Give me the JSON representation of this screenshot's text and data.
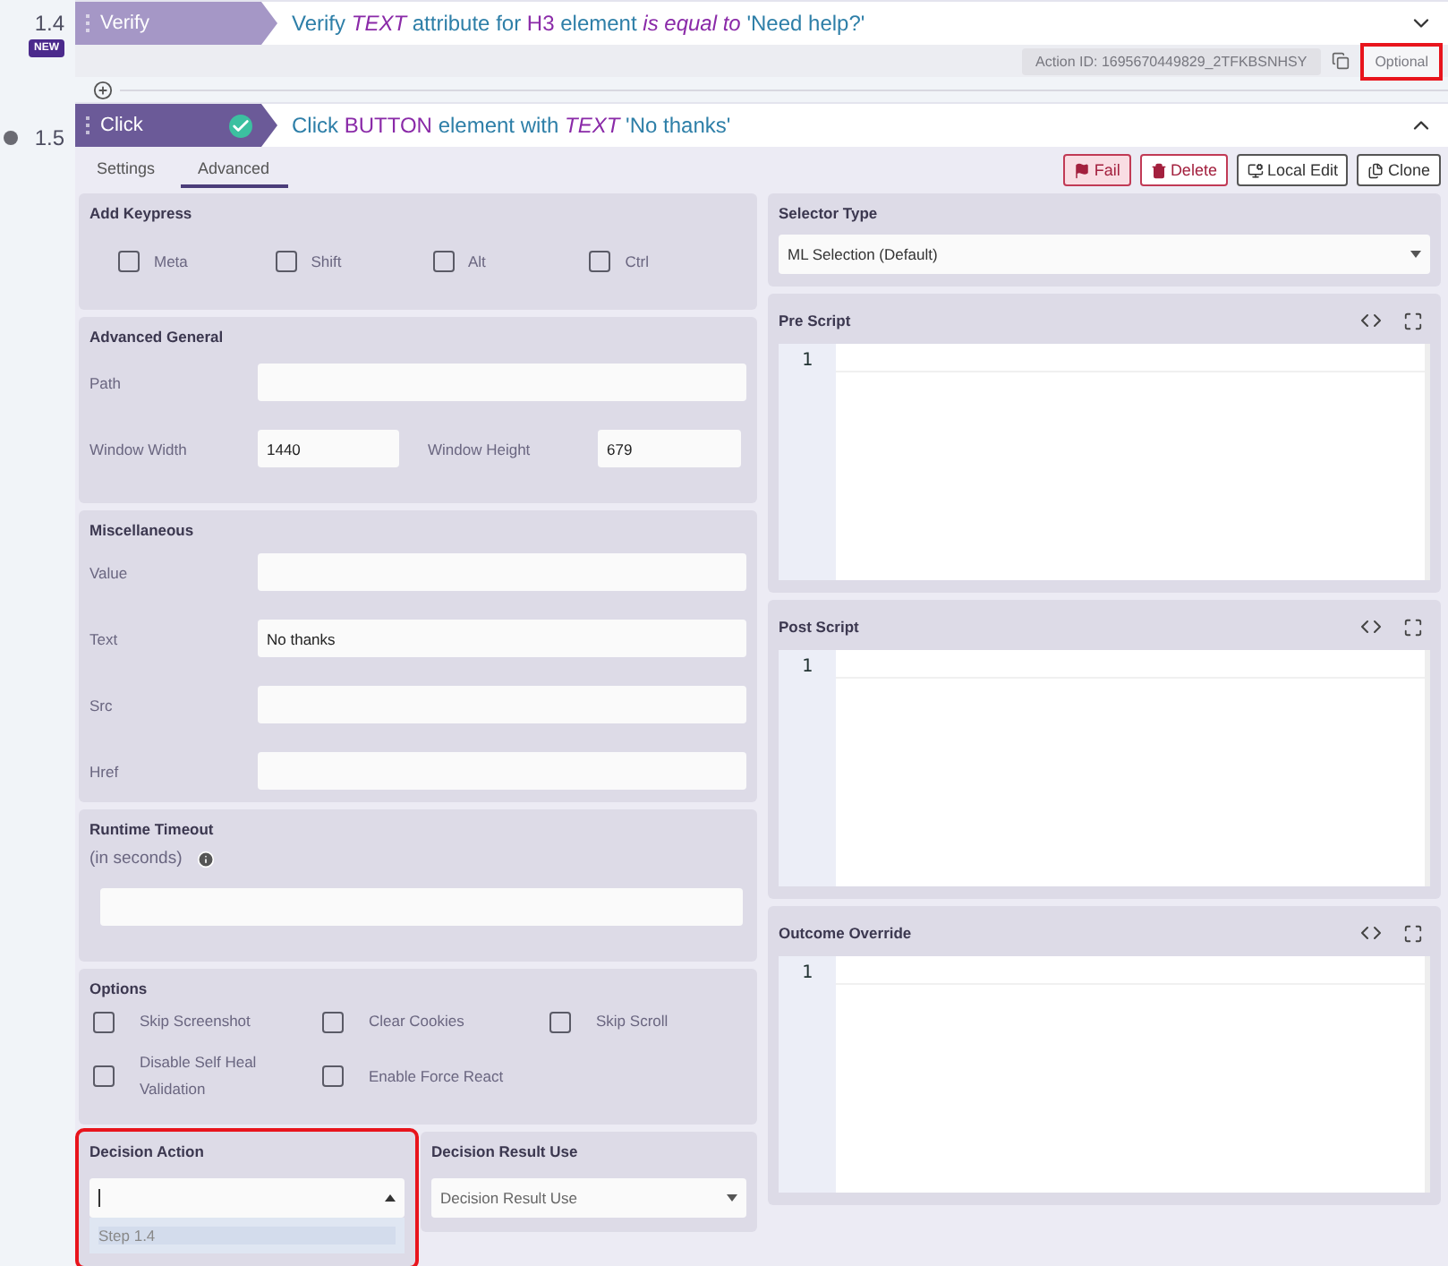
{
  "previous_step": {
    "number": "1.4",
    "badge": "NEW",
    "action": "Verify",
    "active": false,
    "expanded": false,
    "description": [
      {
        "text": "Verify",
        "kind": "plain"
      },
      {
        "text": "TEXT",
        "kind": "em"
      },
      {
        "text": "attribute for",
        "kind": "plain"
      },
      {
        "text": "H3",
        "kind": "key"
      },
      {
        "text": "element",
        "kind": "plain"
      },
      {
        "text": "is equal to",
        "kind": "em"
      },
      {
        "text": "'Need help?'",
        "kind": "plain"
      }
    ],
    "action_id": "Action ID: 1695670449829_2TFKBSNHSY",
    "optional_button": {
      "label": "Optional",
      "highlighted": true
    }
  },
  "current_step": {
    "number": "1.5",
    "action": "Click",
    "active": true,
    "passed": true,
    "expanded": true,
    "description": [
      {
        "text": "Click",
        "kind": "plain"
      },
      {
        "text": "BUTTON",
        "kind": "key"
      },
      {
        "text": "element with",
        "kind": "plain"
      },
      {
        "text": "TEXT",
        "kind": "em"
      },
      {
        "text": "'No thanks'",
        "kind": "plain"
      }
    ],
    "tabs": [
      {
        "label": "Settings",
        "selected": false
      },
      {
        "label": "Advanced",
        "selected": true
      }
    ],
    "buttons": [
      {
        "label": "Fail",
        "kind": "fail"
      },
      {
        "label": "Delete",
        "kind": "delete"
      },
      {
        "label": "Local Edit",
        "kind": "edit"
      },
      {
        "label": "Clone",
        "kind": "clone"
      }
    ]
  },
  "add_keypress": {
    "title": "Add Keypress",
    "options": [
      {
        "label": "Meta",
        "checked": false
      },
      {
        "label": "Shift",
        "checked": false
      },
      {
        "label": "Alt",
        "checked": false
      },
      {
        "label": "Ctrl",
        "checked": false
      }
    ]
  },
  "advanced_general": {
    "title": "Advanced General",
    "path": {
      "label": "Path"
    },
    "window_width": {
      "label": "Window Width",
      "value": "1440"
    },
    "window_height": {
      "label": "Window Height",
      "value": "679"
    }
  },
  "miscellaneous": {
    "title": "Miscellaneous",
    "fields": [
      {
        "label": "Value"
      },
      {
        "label": "Text",
        "value": "No thanks"
      },
      {
        "label": "Src"
      },
      {
        "label": "Href"
      }
    ]
  },
  "runtime_timeout": {
    "title": "Runtime Timeout",
    "subtitle": "(in seconds)"
  },
  "options": {
    "title": "Options",
    "items": [
      {
        "label": "Skip Screenshot",
        "checked": false
      },
      {
        "label": "Clear Cookies",
        "checked": false
      },
      {
        "label": "Skip Scroll",
        "checked": false
      },
      {
        "label": "Disable Self Heal Validation",
        "checked": false
      },
      {
        "label": "Enable Force React",
        "checked": false
      }
    ]
  },
  "decision_action": {
    "title": "Decision Action",
    "highlighted": true,
    "open": true,
    "options": [
      {
        "label": "Step 1.4",
        "selected": true
      }
    ]
  },
  "decision_result_use": {
    "title": "Decision Result Use",
    "placeholder": "Decision Result Use"
  },
  "selector_type": {
    "title": "Selector Type",
    "value": "ML Selection (Default)"
  },
  "scripts": [
    {
      "title": "Pre Script",
      "line_number": "1"
    },
    {
      "title": "Post Script",
      "line_number": "1"
    },
    {
      "title": "Outcome Override",
      "line_number": "1"
    }
  ]
}
